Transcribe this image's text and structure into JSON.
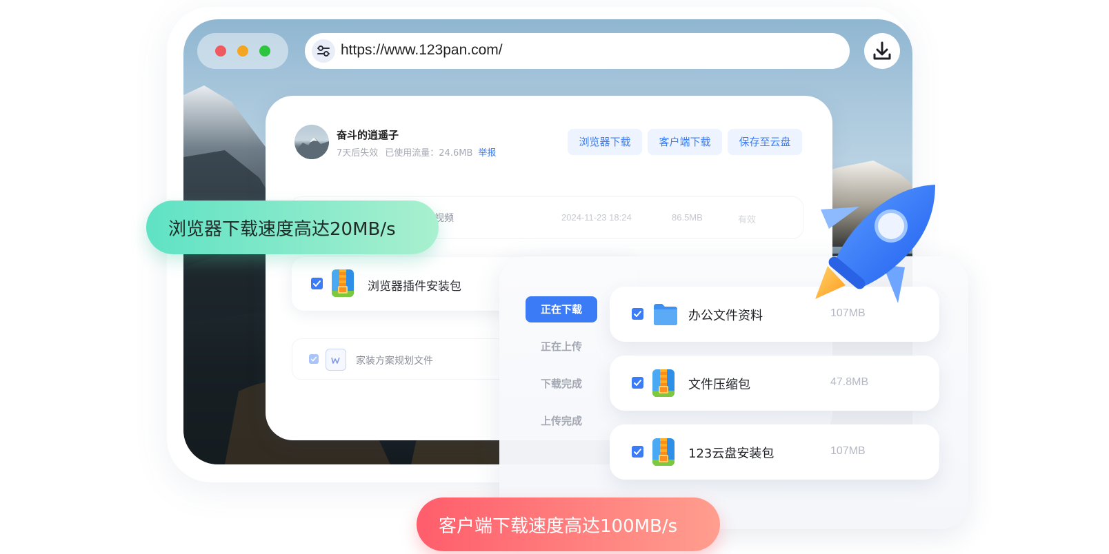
{
  "browser": {
    "url": "https://www.123pan.com/",
    "buttons": [
      "close-dot",
      "minimize-dot",
      "maximize-dot"
    ],
    "download_icon": "download-icon"
  },
  "share": {
    "owner_name": "奋斗的逍遥子",
    "expiry": "7天后失效",
    "traffic": "已使用流量：24.6MB",
    "report": "举报",
    "actions": {
      "browser_download": "浏览器下载",
      "client_download": "客户端下载",
      "save_to_cloud": "保存至云盘"
    },
    "rows": [
      {
        "name": "视频",
        "date": "2024-11-23 18:24",
        "size": "86.5MB",
        "status": "有效"
      },
      {
        "name": "浏览器插件安装包",
        "icon": "zip-icon",
        "checked": true
      },
      {
        "name": "家装方案规划文件",
        "icon": "word-doc-icon",
        "checked": true
      }
    ]
  },
  "client": {
    "tabs": [
      "正在下载",
      "正在上传",
      "下载完成",
      "上传完成"
    ],
    "active_tab": "正在下载",
    "files": [
      {
        "name": "办公文件资料",
        "size": "107MB",
        "icon": "folder-icon",
        "checked": true
      },
      {
        "name": "文件压缩包",
        "size": "47.8MB",
        "icon": "zip-icon",
        "checked": true
      },
      {
        "name": "123云盘安装包",
        "size": "107MB",
        "icon": "zip-icon",
        "checked": true
      }
    ]
  },
  "badges": {
    "browser_speed": "浏览器下载速度高达20MB/s",
    "client_speed": "客户端下载速度高达100MB/s"
  },
  "colors": {
    "accent": "#3b7cf6",
    "green_badge": "#5fe2c4",
    "red_badge": "#ff5d6b"
  }
}
